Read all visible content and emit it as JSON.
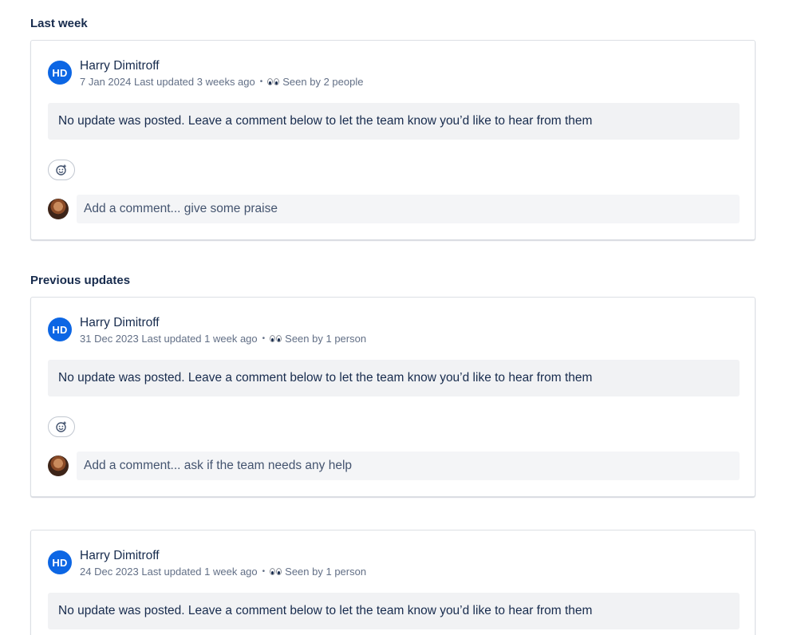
{
  "sections": [
    {
      "heading": "Last week"
    },
    {
      "heading": "Previous updates"
    }
  ],
  "cards": [
    {
      "initials": "HD",
      "author": "Harry Dimitroff",
      "date": "7 Jan 2024",
      "last_updated": "Last updated 3 weeks ago",
      "seen": "Seen by 2 people",
      "notice": "No update was posted. Leave a comment below to let the team know you’d like to hear from them",
      "comment_placeholder": "Add a comment... give some praise"
    },
    {
      "initials": "HD",
      "author": "Harry Dimitroff",
      "date": "31 Dec 2023",
      "last_updated": "Last updated 1 week ago",
      "seen": "Seen by 1 person",
      "notice": "No update was posted. Leave a comment below to let the team know you’d like to hear from them",
      "comment_placeholder": "Add a comment... ask if the team needs any help"
    },
    {
      "initials": "HD",
      "author": "Harry Dimitroff",
      "date": "24 Dec 2023",
      "last_updated": "Last updated 1 week ago",
      "seen": "Seen by 1 person",
      "notice": "No update was posted. Leave a comment below to let the team know you’d like to hear from them"
    }
  ],
  "meta_separator": "•",
  "icons": {
    "seen": "eyes-icon",
    "reaction": "add-reaction-icon"
  },
  "colors": {
    "avatar": "#0c66e4",
    "text": "#172b4d",
    "subtle_text": "#626f86",
    "notice_bg": "#f1f2f4"
  }
}
